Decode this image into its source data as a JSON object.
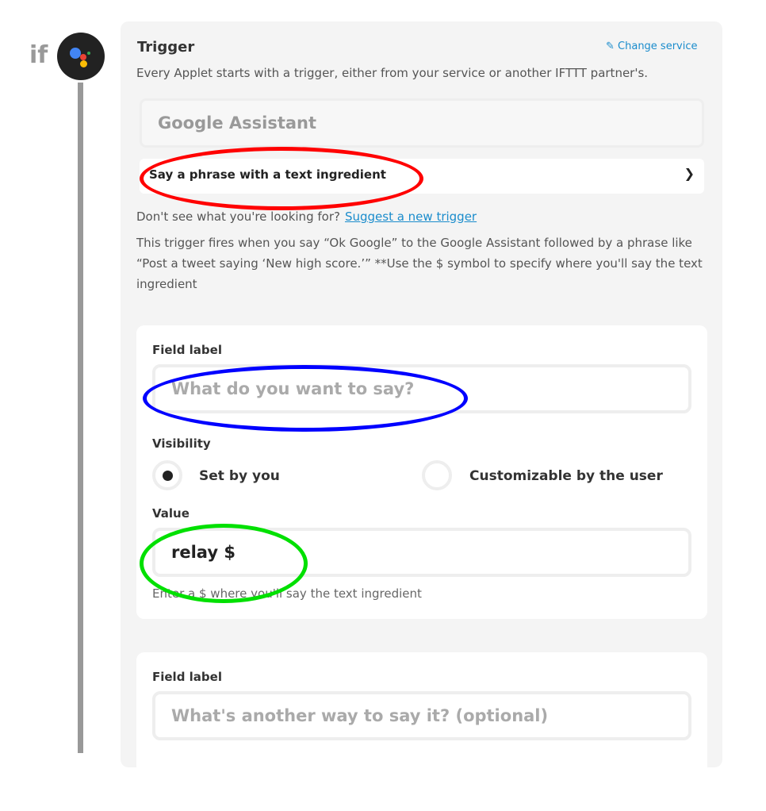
{
  "sidebar": {
    "if_label": "if"
  },
  "trigger": {
    "title": "Trigger",
    "change_service": "Change service",
    "subtitle": "Every Applet starts with a trigger, either from your service or another IFTTT partner's.",
    "service": "Google Assistant",
    "selected_trigger": "Say a phrase with a text ingredient",
    "dont_see": "Don't see what you're looking for?",
    "suggest_link": "Suggest a new trigger",
    "description": "This trigger fires when you say “Ok Google” to the Google Assistant followed by a phrase like “Post a tweet saying ‘New high score.’” **Use the $ symbol to specify where you'll say the text ingredient"
  },
  "field1": {
    "label": "Field label",
    "placeholder": "What do you want to say?",
    "visibility_label": "Visibility",
    "option_set": "Set by you",
    "option_custom": "Customizable by the user",
    "value_label": "Value",
    "value": "relay $",
    "hint": "Enter a $ where you'll say the text ingredient"
  },
  "field2": {
    "label": "Field label",
    "placeholder": "What's another way to say it? (optional)"
  },
  "colors": {
    "accent": "#1a8ccc",
    "red_mark": "#ff0000",
    "blue_mark": "#0000ff",
    "green_mark": "#00e000"
  }
}
